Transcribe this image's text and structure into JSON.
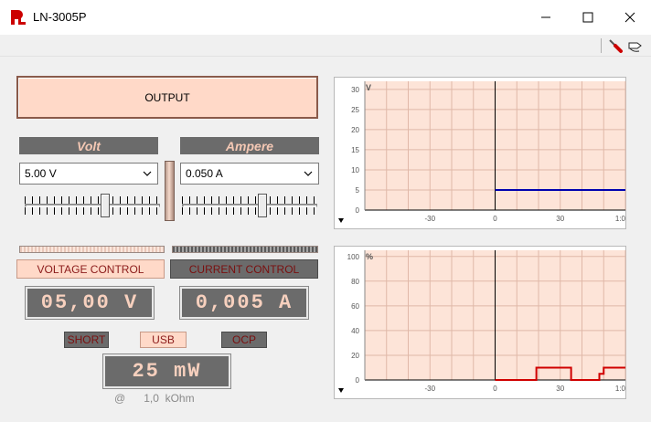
{
  "window": {
    "title": "LN-3005P",
    "logo_text": "PL"
  },
  "output_button": {
    "label": "OUTPUT"
  },
  "volt": {
    "header": "Volt",
    "selected": "5.00 V",
    "slider_fraction": 0.6
  },
  "ampere": {
    "header": "Ampere",
    "selected": "0.050 A",
    "slider_fraction": 0.6
  },
  "modes": {
    "voltage_control": "VOLTAGE CONTROL",
    "current_control": "CURRENT CONTROL",
    "active": "voltage"
  },
  "readouts": {
    "voltage": "05,00  V",
    "current": "0,005  A",
    "power": "25  mW"
  },
  "indicators": {
    "short": "SHORT",
    "usb": "USB",
    "ocp": "OCP",
    "active": "usb"
  },
  "load": {
    "at": "@",
    "value": "1,0",
    "unit": "kOhm"
  },
  "colors": {
    "panel_peach": "#ffd9c8",
    "panel_gray": "#6b6b6b",
    "chart_bg": "#fde4d8",
    "voltage_trace": "#0000b0",
    "percent_trace": "#d00000"
  },
  "icons": [
    "close-icon",
    "maximize-icon",
    "minimize-icon",
    "screwdriver-icon",
    "probe-icon",
    "chevron-down-icon",
    "down-arrow-icon"
  ],
  "chart_data": [
    {
      "type": "line",
      "title": "",
      "unit_label": "V",
      "xlabel": "",
      "ylabel": "",
      "x_ticks": [
        "-30",
        "0",
        "30",
        "1:0"
      ],
      "y_ticks": [
        "0",
        "5",
        "10",
        "15",
        "20",
        "25",
        "30"
      ],
      "xlim": [
        -60,
        60
      ],
      "ylim": [
        0,
        32
      ],
      "grid": true,
      "series": [
        {
          "x": [
            0,
            60
          ],
          "y": [
            5,
            5
          ]
        }
      ]
    },
    {
      "type": "line",
      "title": "",
      "unit_label": "%",
      "xlabel": "",
      "ylabel": "",
      "x_ticks": [
        "-30",
        "0",
        "30",
        "1:0"
      ],
      "y_ticks": [
        "0",
        "20",
        "40",
        "60",
        "80",
        "100"
      ],
      "xlim": [
        -60,
        60
      ],
      "ylim": [
        0,
        105
      ],
      "grid": true,
      "series": [
        {
          "x": [
            0,
            19,
            19,
            35,
            35,
            48,
            48,
            50,
            50,
            60
          ],
          "y": [
            0,
            0,
            10,
            10,
            0,
            0,
            5,
            5,
            10,
            10
          ]
        }
      ]
    }
  ]
}
